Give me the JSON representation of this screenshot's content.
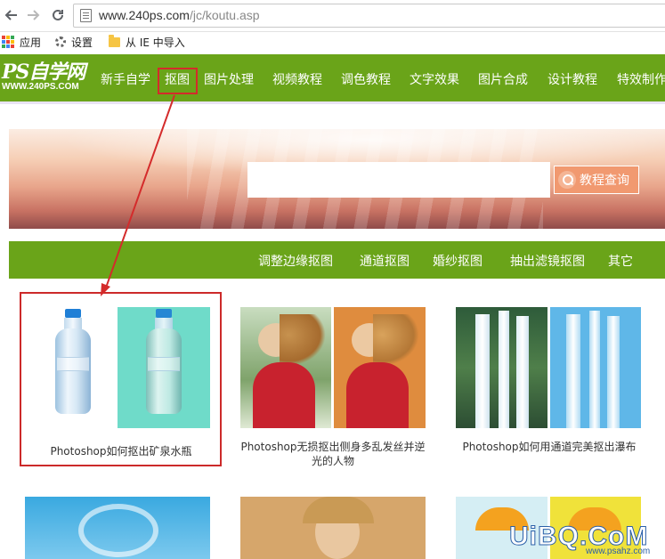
{
  "browser": {
    "url_host": "www.240ps.com",
    "url_path": "/jc/koutu.asp",
    "back_icon": "arrow-left",
    "forward_icon": "arrow-right",
    "reload_icon": "reload",
    "bookmarks": [
      {
        "label": "应用",
        "icon": "apps-grid-icon"
      },
      {
        "label": "设置",
        "icon": "gear-icon"
      },
      {
        "label": "从 IE 中导入",
        "icon": "folder-icon"
      }
    ]
  },
  "site": {
    "logo_text": "PS自学网",
    "logo_domain": "WWW.240PS.COM",
    "nav": [
      "新手自学",
      "抠图",
      "图片处理",
      "视频教程",
      "调色教程",
      "文字效果",
      "图片合成",
      "设计教程",
      "特效制作"
    ],
    "search_button": "教程查询",
    "subnav": [
      "调整边缘抠图",
      "通道抠图",
      "婚纱抠图",
      "抽出滤镜抠图",
      "其它"
    ]
  },
  "cards": [
    {
      "caption": "Photoshop如何抠出矿泉水瓶"
    },
    {
      "caption": "Photoshop无损抠出侧身多乱发丝并逆光的人物"
    },
    {
      "caption": "Photoshop如何用通道完美抠出瀑布"
    }
  ],
  "watermark": {
    "text": "UiBQ.CoM",
    "sub": "www.psahz.com"
  },
  "colors": {
    "site_green": "#6aa419",
    "highlight_red": "#cc2a2a",
    "search_orange": "#f19970"
  }
}
